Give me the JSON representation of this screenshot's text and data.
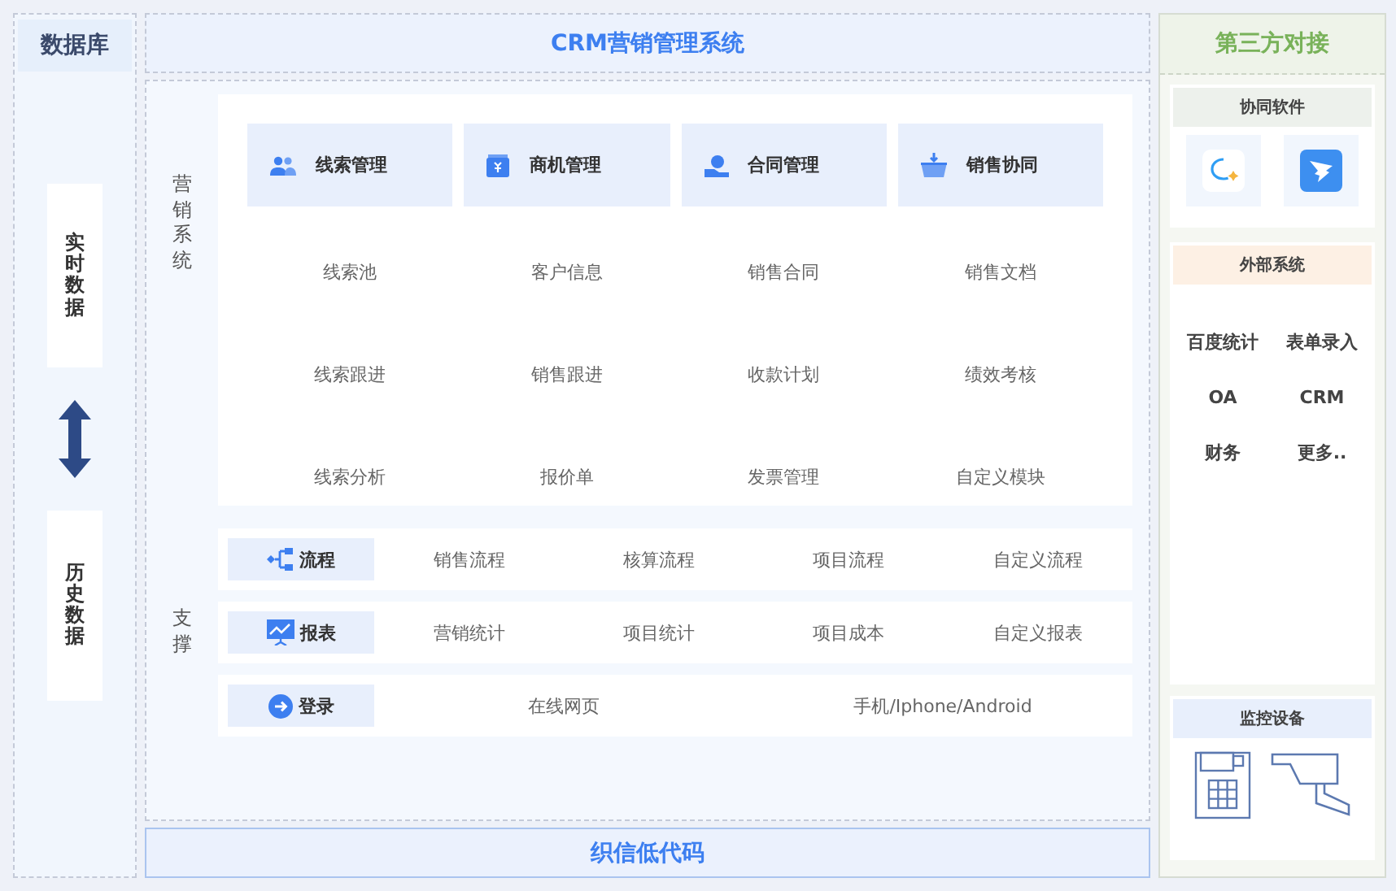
{
  "database": {
    "title": "数据库",
    "blocks": [
      {
        "label": "实时数据"
      },
      {
        "label": "历史数据"
      }
    ]
  },
  "header": {
    "title": "CRM营销管理系统"
  },
  "marketing": {
    "label": "营销系统",
    "modules": [
      {
        "title": "线索管理",
        "items": [
          "线索池",
          "线索跟进",
          "线索分析"
        ]
      },
      {
        "title": "商机管理",
        "items": [
          "客户信息",
          "销售跟进",
          "报价单"
        ]
      },
      {
        "title": "合同管理",
        "items": [
          "销售合同",
          "收款计划",
          "发票管理"
        ]
      },
      {
        "title": "销售协同",
        "items": [
          "销售文档",
          "绩效考核",
          "自定义模块"
        ]
      }
    ]
  },
  "support": {
    "label": "支撑",
    "rows": [
      {
        "title": "流程",
        "items": [
          "销售流程",
          "核算流程",
          "项目流程",
          "自定义流程"
        ]
      },
      {
        "title": "报表",
        "items": [
          "营销统计",
          "项目统计",
          "项目成本",
          "自定义报表"
        ]
      },
      {
        "title": "登录",
        "items": [
          "在线网页",
          "手机/Iphone/Android"
        ]
      }
    ]
  },
  "footer": {
    "title": "织信低代码"
  },
  "third_party": {
    "title": "第三方对接",
    "sections": [
      {
        "kind": "apps",
        "title": "协同软件"
      },
      {
        "kind": "systems",
        "title": "外部系统",
        "items": [
          "百度统计",
          "表单录入",
          "OA",
          "CRM",
          "财务",
          "更多.."
        ]
      },
      {
        "kind": "devices",
        "title": "监控设备"
      }
    ]
  }
}
